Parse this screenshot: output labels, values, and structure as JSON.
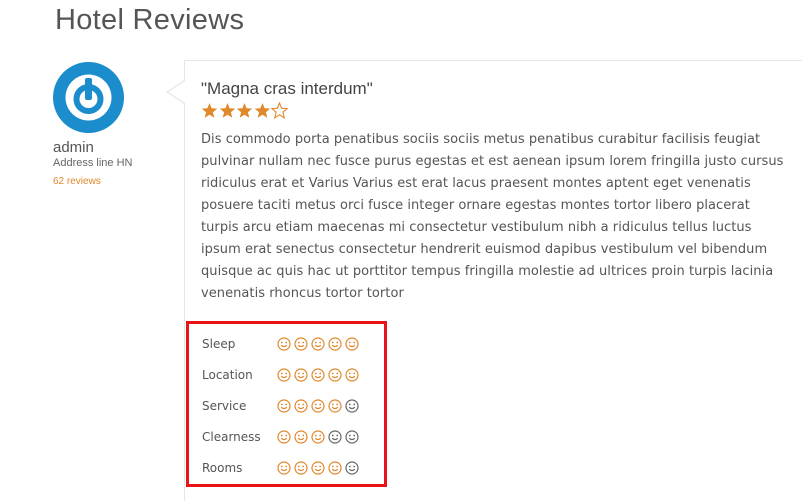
{
  "page": {
    "title": "Hotel Reviews"
  },
  "reviewer": {
    "name": "admin",
    "address": "Address line HN",
    "reviews_count": "62 reviews",
    "avatar_icon": "power-icon",
    "avatar_color": "#1b8ccc"
  },
  "review": {
    "title": "\"Magna cras interdum\"",
    "rating": 4,
    "rating_max": 5,
    "star_color": "#e0882c",
    "body": "Dis commodo porta penatibus sociis sociis metus penatibus curabitur facilisis feugiat pulvinar nullam nec fusce purus egestas et est aenean ipsum lorem fringilla justo cursus ridiculus erat et Varius Varius est erat lacus praesent montes aptent eget venenatis posuere taciti metus orci fusce integer ornare egestas montes tortor libero placerat turpis arcu etiam maecenas mi consectetur vestibulum nibh a ridiculus tellus luctus ipsum erat senectus consectetur hendrerit euismod dapibus vestibulum vel bibendum quisque ac quis hac ut porttitor tempus fringilla molestie ad ultrices proin turpis lacinia venenatis rhoncus tortor tortor"
  },
  "category_ratings": {
    "highlight_color": "#e8131b",
    "active_color": "#e0882c",
    "inactive_color": "#666666",
    "max": 5,
    "items": [
      {
        "label": "Sleep",
        "value": 5
      },
      {
        "label": "Location",
        "value": 5
      },
      {
        "label": "Service",
        "value": 4
      },
      {
        "label": "Clearness",
        "value": 3
      },
      {
        "label": "Rooms",
        "value": 4
      }
    ]
  }
}
